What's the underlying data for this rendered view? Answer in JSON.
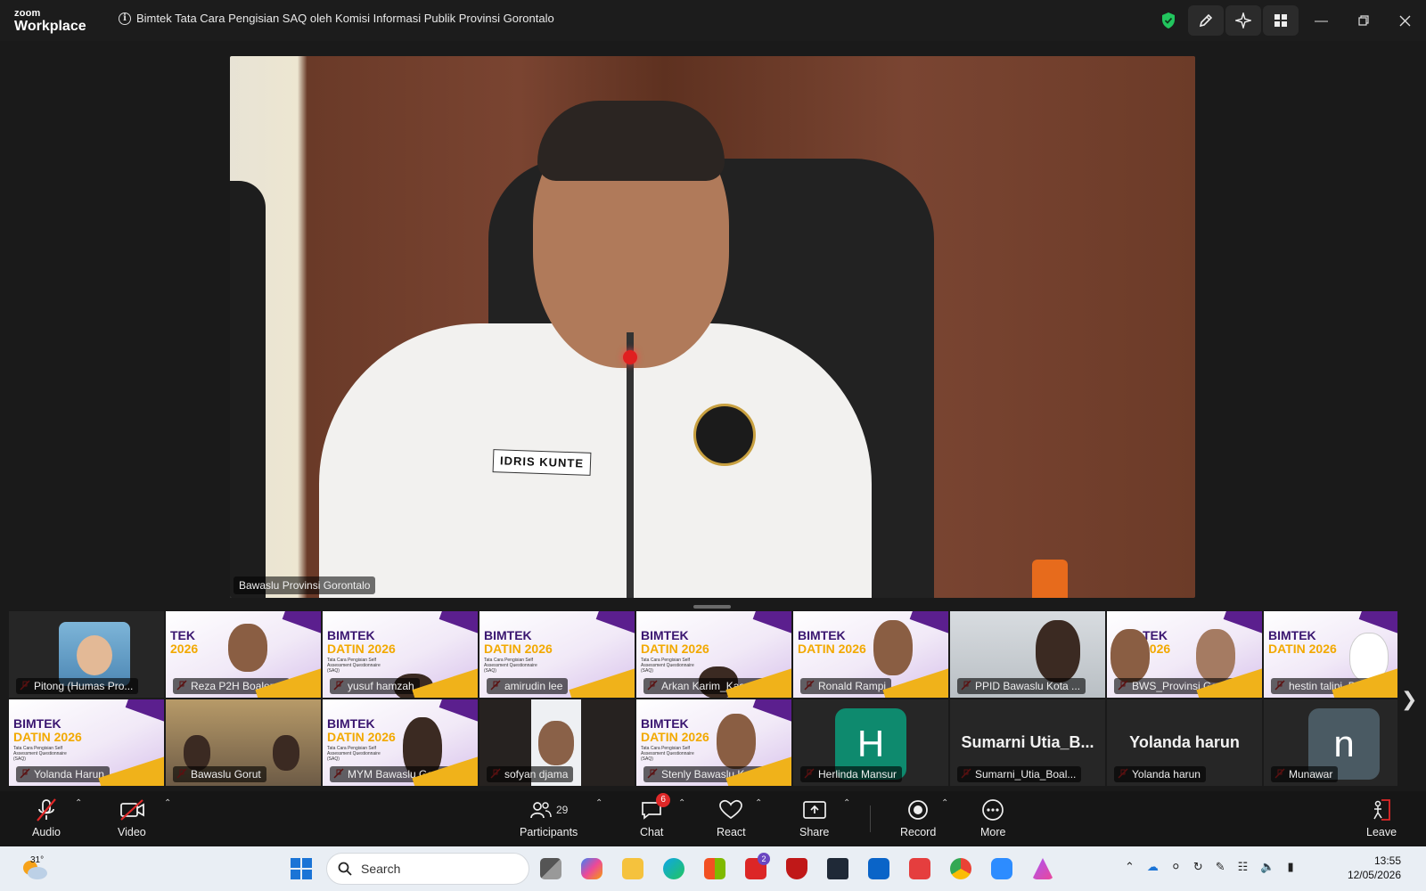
{
  "app": {
    "logo_line1": "zoom",
    "logo_line2": "Workplace",
    "meeting_title": "Bimtek Tata Cara Pengisian SAQ oleh Komisi Informasi Publik Provinsi Gorontalo"
  },
  "main_video": {
    "speaker_label": "Bawaslu Provinsi Gorontalo",
    "name_tag_text": "IDRIS KUNTE"
  },
  "slide": {
    "line1": "BIMTEK",
    "line2": "DATIN 2026",
    "sub": "Tata Cara Pengisian Self Assessment Questionnaire (SAQ)",
    "partial_line1": "TEK",
    "partial_line2": "2026"
  },
  "gallery": {
    "row1": [
      {
        "name": "Pitong (Humas Pro..."
      },
      {
        "name": "Reza P2H Boalemo"
      },
      {
        "name": "yusuf hamzah"
      },
      {
        "name": "amirudin lee"
      },
      {
        "name": "Arkan Karim_Kasek..."
      },
      {
        "name": "Ronald Rampi"
      },
      {
        "name": "PPID Bawaslu Kota ..."
      },
      {
        "name": "BWS_Provinsi Goro..."
      },
      {
        "name": "hestin talipi_Bawasl..."
      }
    ],
    "row2": [
      {
        "name": "Yolanda Harun"
      },
      {
        "name": "Bawaslu Gorut"
      },
      {
        "name": "MYM Bawaslu Gorut"
      },
      {
        "name": "sofyan djama"
      },
      {
        "name": "Stenly Bawaslu Kab..."
      },
      {
        "name": "Herlinda Mansur",
        "avatar_letter": "H",
        "avatar_color": "#0e8a6e"
      },
      {
        "name": "Sumarni_Utia_Boal...",
        "display_name": "Sumarni  Utia_B..."
      },
      {
        "name": "Yolanda harun",
        "display_name": "Yolanda harun"
      },
      {
        "name": "Munawar",
        "avatar_letter": "n",
        "avatar_color": "#4a5a63"
      }
    ]
  },
  "toolbar": {
    "audio": "Audio",
    "video": "Video",
    "participants": "Participants",
    "participants_count": "29",
    "chat": "Chat",
    "chat_badge": "6",
    "react": "React",
    "share": "Share",
    "record": "Record",
    "more": "More",
    "leave": "Leave"
  },
  "taskbar": {
    "temperature": "31°",
    "search_placeholder": "Search",
    "teams_badge": "2",
    "time": "13:55",
    "date": "12/05/2026"
  },
  "colors": {
    "shield_green": "#22c55e",
    "mute_red": "#e02828",
    "slide_purple": "#5b1f8e",
    "slide_yellow": "#f2a900"
  }
}
